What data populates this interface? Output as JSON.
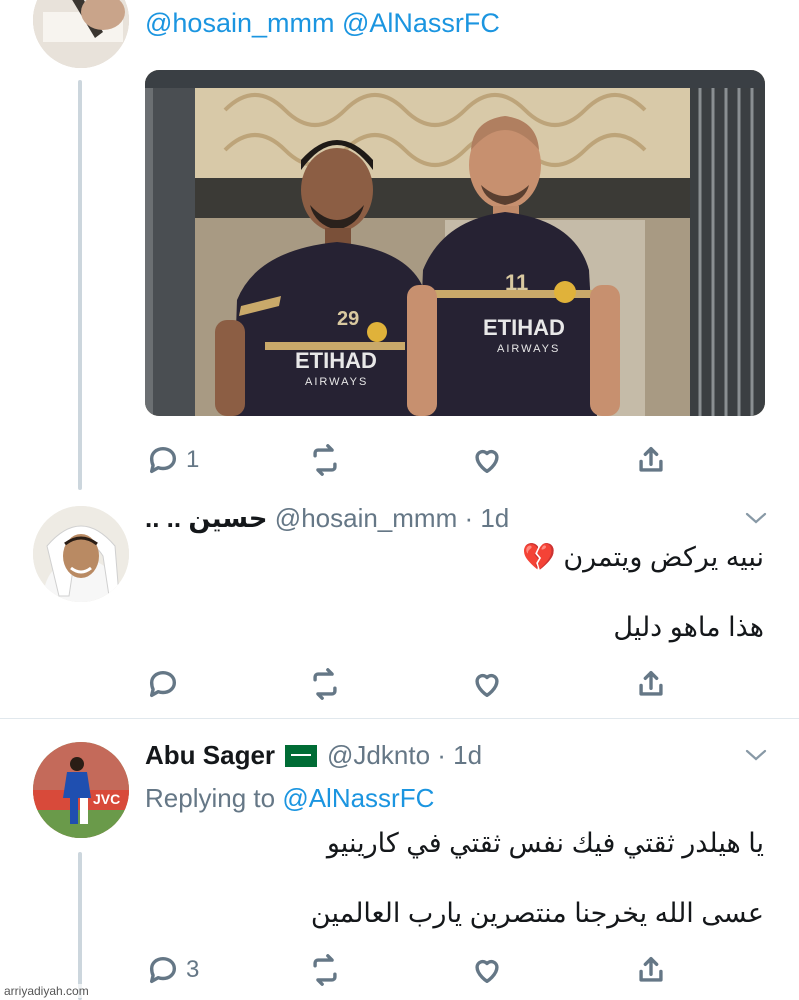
{
  "tweet1": {
    "mentions": "@hosain_mmm @AlNassrFC",
    "image_text": {
      "jersey_left": "ETIHAD",
      "jersey_left_sub": "AIRWAYS",
      "jersey_right": "ETIHAD",
      "jersey_right_sub": "AIRWAYS",
      "num_left": "29",
      "num_right": "11"
    },
    "reply_count": "1"
  },
  "tweet2": {
    "name": "حسين .. ..",
    "handle_time": "@hosain_mmm · 1d",
    "line1": "نبيه يركض ويتمرن 💔",
    "line2": "هذا ماهو دليل"
  },
  "tweet3": {
    "name": "Abu Sager",
    "flag": "🇸🇦",
    "handle_time": "@Jdknto · 1d",
    "replying_prefix": "Replying to",
    "replying_handle": "@AlNassrFC",
    "line1": "يا هيلدر ثقتي فيك نفس ثقتي في كارينيو",
    "line2": "عسى الله يخرجنا منتصرين يارب العالمين",
    "reply_count": "3"
  },
  "watermark": "arriyadiyah.com"
}
